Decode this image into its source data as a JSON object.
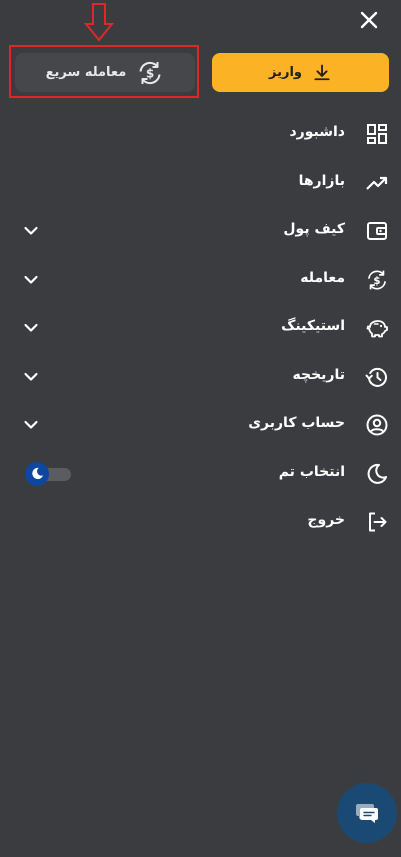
{
  "header": {
    "close_icon": "close-icon"
  },
  "actions": {
    "deposit_label": "واریز",
    "deposit_icon": "download-icon",
    "quick_trade_label": "معامله سریع",
    "quick_trade_icon": "currency-exchange-icon"
  },
  "annotation": {
    "color": "#e0262b"
  },
  "menu": {
    "items": [
      {
        "label": "داشبورد",
        "icon": "dashboard-icon",
        "expandable": false
      },
      {
        "label": "بازارها",
        "icon": "trending-up-icon",
        "expandable": false
      },
      {
        "label": "کیف پول",
        "icon": "wallet-icon",
        "expandable": true
      },
      {
        "label": "معامله",
        "icon": "currency-exchange-icon",
        "expandable": true
      },
      {
        "label": "استیکینگ",
        "icon": "piggy-bank-icon",
        "expandable": true
      },
      {
        "label": "تاریخچه",
        "icon": "history-icon",
        "expandable": true
      },
      {
        "label": "حساب کاربری",
        "icon": "user-circle-icon",
        "expandable": true
      },
      {
        "label": "انتخاب تم",
        "icon": "moon-icon",
        "expandable": false,
        "toggle_on": true
      },
      {
        "label": "خروج",
        "icon": "logout-icon",
        "expandable": false
      }
    ]
  },
  "colors": {
    "background": "#3b3c3f",
    "accent": "#fbb325",
    "quick_trade_bg": "#46474a",
    "toggle_knob": "#0d47a1",
    "chat_bg": "#1a4a73"
  },
  "chat": {
    "icon": "chat-icon"
  }
}
